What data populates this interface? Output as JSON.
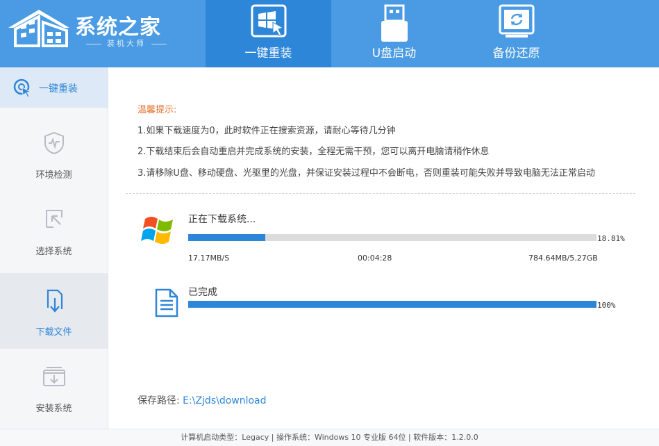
{
  "logo": {
    "title": "系统之家",
    "subtitle": "装机大师"
  },
  "top_tabs": [
    {
      "label": "一键重装",
      "icon": "windows-cursor-icon",
      "active": true
    },
    {
      "label": "U盘启动",
      "icon": "usb-drive-icon",
      "active": false
    },
    {
      "label": "备份还原",
      "icon": "backup-restore-icon",
      "active": false
    }
  ],
  "sidebar": {
    "items": [
      {
        "label": "一键重装",
        "icon": "reinstall-cursor-icon"
      },
      {
        "label": "环境检测",
        "icon": "shield-pulse-icon"
      },
      {
        "label": "选择系统",
        "icon": "select-cursor-icon"
      },
      {
        "label": "下载文件",
        "icon": "download-file-icon"
      },
      {
        "label": "安装系统",
        "icon": "install-box-icon"
      }
    ]
  },
  "tips": {
    "title": "温馨提示:",
    "items": [
      "1.如果下载速度为0，此时软件正在搜索资源，请耐心等待几分钟",
      "2.下载结束后会自动重启并完成系统的安装，全程无需干预，您可以离开电脑请稍作休息",
      "3.请移除U盘、移动硬盘、光驱里的光盘，并保证安装过程中不会断电，否则重装可能失败并导致电脑无法正常启动"
    ]
  },
  "download": {
    "status": "正在下载系统...",
    "progress_percent": 18.81,
    "progress_label": "18.81%",
    "speed": "17.17MB/S",
    "elapsed": "00:04:28",
    "size": "784.64MB/5.27GB"
  },
  "completed": {
    "status": "已完成",
    "progress_percent": 100,
    "progress_label": "100%"
  },
  "save_path": {
    "label": "保存路径:",
    "value": "E:\\Zjds\\download"
  },
  "footer": {
    "text": "计算机启动类型：Legacy | 操作系统：Windows 10 专业版 64位 | 软件版本：1.2.0.0"
  },
  "colors": {
    "header": "#4a9be3",
    "active_tab": "#2e86d9",
    "accent": "#2e86d9",
    "tip_title": "#e5722c",
    "progress_track": "#dcdcdc"
  }
}
